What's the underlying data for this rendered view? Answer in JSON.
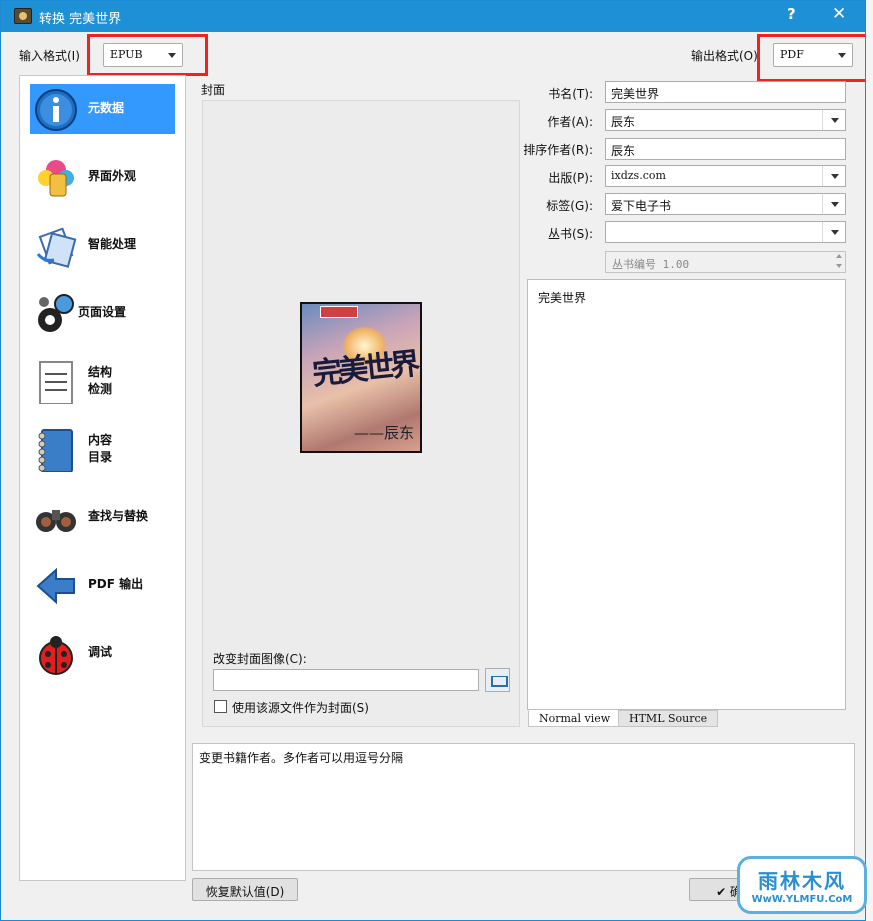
{
  "window": {
    "title": "转换 完美世界",
    "help": "?",
    "close": "✕"
  },
  "input_format": {
    "label": "输入格式(I)",
    "value": "EPUB"
  },
  "output_format": {
    "label": "输出格式(O)",
    "value": "PDF"
  },
  "sidebar": {
    "items": [
      {
        "label": "元数据",
        "icon": "info-icon",
        "active": true
      },
      {
        "label": "界面外观",
        "icon": "paint-icon"
      },
      {
        "label": "智能处理",
        "icon": "wand-icon"
      },
      {
        "label": "页面设置",
        "icon": "gear-icon"
      },
      {
        "label": "结构\n检测",
        "icon": "document-icon"
      },
      {
        "label": "内容\n目录",
        "icon": "notebook-icon"
      },
      {
        "label": "查找与替换",
        "icon": "binoculars-icon"
      },
      {
        "label": "PDF 输出",
        "icon": "arrow-left-icon"
      },
      {
        "label": "调试",
        "icon": "ladybug-icon"
      }
    ]
  },
  "cover": {
    "label": "封面",
    "image_title": "完美世界",
    "image_author": "——辰东",
    "change_label": "改变封面图像(C):",
    "change_value": "",
    "use_source_label": "使用该源文件作为封面(S)"
  },
  "metadata": {
    "title_label": "书名(T):",
    "title_value": "完美世界",
    "author_label": "作者(A):",
    "author_value": "辰东",
    "sort_author_label": "排序作者(R):",
    "sort_author_value": "辰东",
    "publisher_label": "出版(P):",
    "publisher_value": "ixdzs.com",
    "tags_label": "标签(G):",
    "tags_value": "爱下电子书",
    "series_label": "丛书(S):",
    "series_value": "",
    "series_index": "丛书编号 1.00"
  },
  "comments": {
    "text": "完美世界",
    "tab_normal": "Normal view",
    "tab_html": "HTML Source"
  },
  "help_text": "变更书籍作者。多作者可以用逗号分隔",
  "buttons": {
    "restore": "恢复默认值(D)",
    "ok": "✔ 确"
  },
  "watermark": {
    "line1": "雨林木风",
    "line2": "WwW.YLMFU.CoM"
  }
}
